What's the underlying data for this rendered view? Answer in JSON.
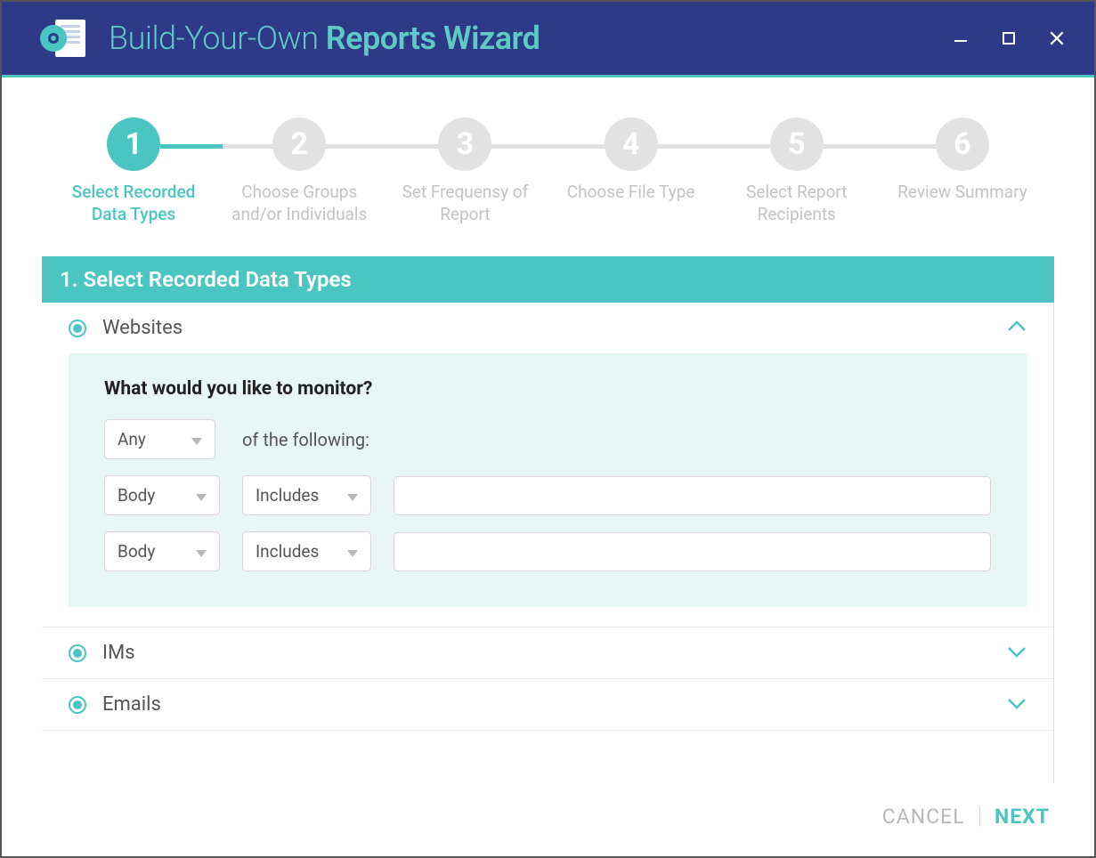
{
  "titlebar": {
    "title_light": "Build-Your-Own ",
    "title_bold": "Reports Wizard"
  },
  "stepper": {
    "steps": [
      {
        "num": "1",
        "label": "Select Recorded Data Types",
        "active": true
      },
      {
        "num": "2",
        "label": "Choose Groups and/or Individuals",
        "active": false
      },
      {
        "num": "3",
        "label": "Set Frequensy of Report",
        "active": false
      },
      {
        "num": "4",
        "label": "Choose File Type",
        "active": false
      },
      {
        "num": "5",
        "label": "Select Report Recipients",
        "active": false
      },
      {
        "num": "6",
        "label": "Review Summary",
        "active": false
      }
    ]
  },
  "section": {
    "header": "1. Select Recorded Data Types",
    "items": [
      {
        "title": "Websites",
        "expanded": true,
        "body": {
          "question": "What would you like to monitor?",
          "quantifier": "Any",
          "following_text": "of the following:",
          "rules": [
            {
              "field": "Body",
              "op": "Includes",
              "value": ""
            },
            {
              "field": "Body",
              "op": "Includes",
              "value": ""
            }
          ]
        }
      },
      {
        "title": "IMs",
        "expanded": false
      },
      {
        "title": "Emails",
        "expanded": false
      }
    ]
  },
  "footer": {
    "cancel": "CANCEL",
    "next": "NEXT"
  },
  "colors": {
    "accent": "#4ac5c1",
    "titlebar": "#2e3a87",
    "inactive": "#e2e2e2"
  }
}
